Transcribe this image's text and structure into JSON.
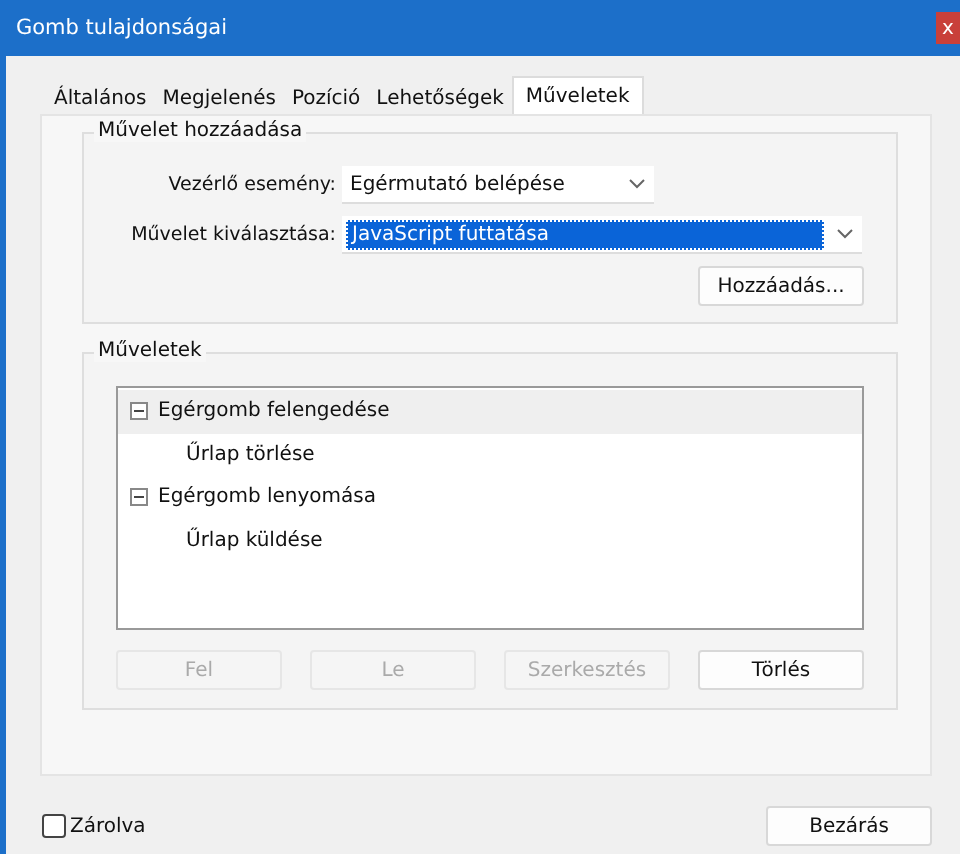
{
  "window": {
    "title": "Gomb tulajdonságai",
    "close": "x"
  },
  "tabs": [
    {
      "label": "Általános",
      "selected": false
    },
    {
      "label": "Megjelenés",
      "selected": false
    },
    {
      "label": "Pozíció",
      "selected": false
    },
    {
      "label": "Lehetőségek",
      "selected": false
    },
    {
      "label": "Műveletek",
      "selected": true
    }
  ],
  "add_group": {
    "title": "Művelet hozzáadása",
    "fields": [
      {
        "label": "Vezérlő esemény:",
        "value": "Egérmutató belépése",
        "highlighted": false
      },
      {
        "label": "Művelet kiválasztása:",
        "value": "JavaScript futtatása",
        "highlighted": true
      }
    ],
    "button": "Hozzáadás..."
  },
  "actions_group": {
    "title": "Műveletek",
    "tree": [
      {
        "label": "Egérgomb felengedése",
        "expanded": true,
        "selected": true,
        "children": [
          {
            "label": "Űrlap törlése",
            "selected": false
          }
        ]
      },
      {
        "label": "Egérgomb lenyomása",
        "expanded": true,
        "selected": false,
        "children": [
          {
            "label": "Űrlap küldése",
            "selected": false
          }
        ]
      }
    ],
    "buttons": [
      {
        "label": "Fel",
        "disabled": true
      },
      {
        "label": "Le",
        "disabled": true
      },
      {
        "label": "Szerkesztés",
        "disabled": true
      },
      {
        "label": "Törlés",
        "disabled": false
      }
    ]
  },
  "locked": {
    "label": "Zárolva",
    "checked": false
  },
  "close_button": "Bezárás"
}
